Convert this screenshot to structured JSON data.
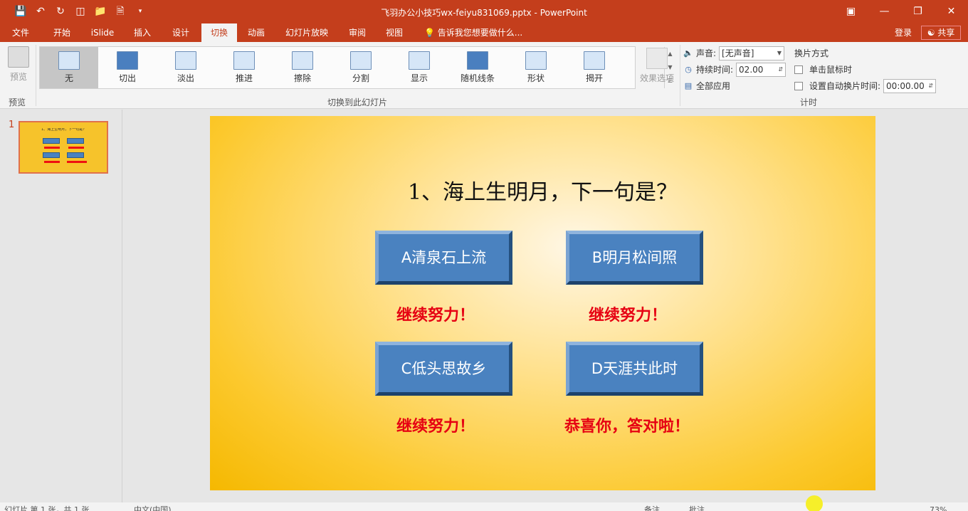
{
  "titlebar": {
    "title": "飞羽办公小技巧wx-feiyu831069.pptx - PowerPoint",
    "quick_access": [
      "save-icon",
      "undo-icon",
      "redo-icon",
      "slideshow-icon",
      "open-icon",
      "new-icon",
      "customize-icon"
    ]
  },
  "tabs": {
    "items": [
      "文件",
      "开始",
      "iSlide",
      "插入",
      "设计",
      "切换",
      "动画",
      "幻灯片放映",
      "审阅",
      "视图"
    ],
    "active": "切换",
    "tell_me": "告诉我您想要做什么...",
    "login": "登录",
    "share": "共享"
  },
  "ribbon": {
    "preview": {
      "button": "预览",
      "group": "预览"
    },
    "transitions": {
      "group": "切换到此幻灯片",
      "items": [
        "无",
        "切出",
        "淡出",
        "推进",
        "擦除",
        "分割",
        "显示",
        "随机线条",
        "形状",
        "揭开"
      ],
      "selected": "无"
    },
    "effect_options": "效果选项",
    "timing": {
      "group": "计时",
      "sound_label": "声音:",
      "sound_value": "[无声音]",
      "duration_label": "持续时间:",
      "duration_value": "02.00",
      "apply_all": "全部应用",
      "advance_title": "换片方式",
      "on_click": "单击鼠标时",
      "after_label": "设置自动换片时间:",
      "after_value": "00:00.00"
    }
  },
  "thumbnails": {
    "slide_number": "1",
    "title": "1、海上生明月，下一句是？"
  },
  "slide": {
    "question": "1、海上生明月，下一句是？",
    "answers": [
      {
        "label": "A清泉石上流",
        "result": "继续努力！"
      },
      {
        "label": "B明月松间照",
        "result": "继续努力！"
      },
      {
        "label": "C低头思故乡",
        "result": "继续努力！"
      },
      {
        "label": "D天涯共此时",
        "result": "恭喜你，答对啦！"
      }
    ]
  },
  "statusbar": {
    "slide_info": "幻灯片 第 1 张，共 1 张",
    "language": "中文(中国)",
    "notes": "备注",
    "comments": "批注",
    "zoom": "73%"
  }
}
